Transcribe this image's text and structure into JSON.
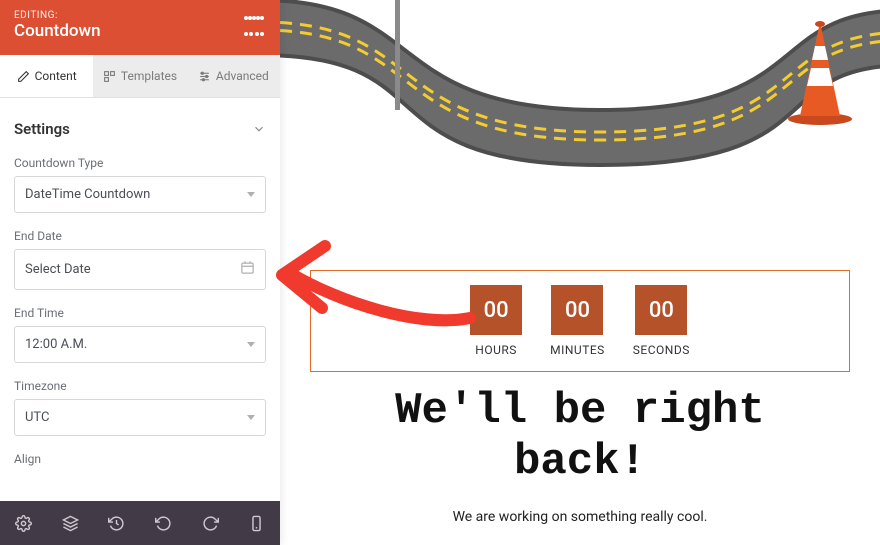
{
  "sidebar": {
    "editing_label": "EDITING:",
    "widget_name": "Countdown",
    "tabs": [
      {
        "label": "Content"
      },
      {
        "label": "Templates"
      },
      {
        "label": "Advanced"
      }
    ],
    "section_title": "Settings",
    "fields": {
      "countdown_type": {
        "label": "Countdown Type",
        "value": "DateTime Countdown"
      },
      "end_date": {
        "label": "End Date",
        "placeholder": "Select Date"
      },
      "end_time": {
        "label": "End Time",
        "value": "12:00 A.M."
      },
      "timezone": {
        "label": "Timezone",
        "value": "UTC"
      },
      "align": {
        "label": "Align"
      }
    }
  },
  "preview": {
    "countdown": [
      {
        "value": "00",
        "label": "HOURS"
      },
      {
        "value": "00",
        "label": "MINUTES"
      },
      {
        "value": "00",
        "label": "SECONDS"
      }
    ],
    "headline": "We'll be right back!",
    "subline": "We are working on something really cool."
  },
  "colors": {
    "accent": "#dd4f32",
    "countdown_block": "#b5522a",
    "countdown_border": "#e46a2e",
    "toolbar_bg": "#433a47",
    "arrow": "#ef3a2d"
  }
}
